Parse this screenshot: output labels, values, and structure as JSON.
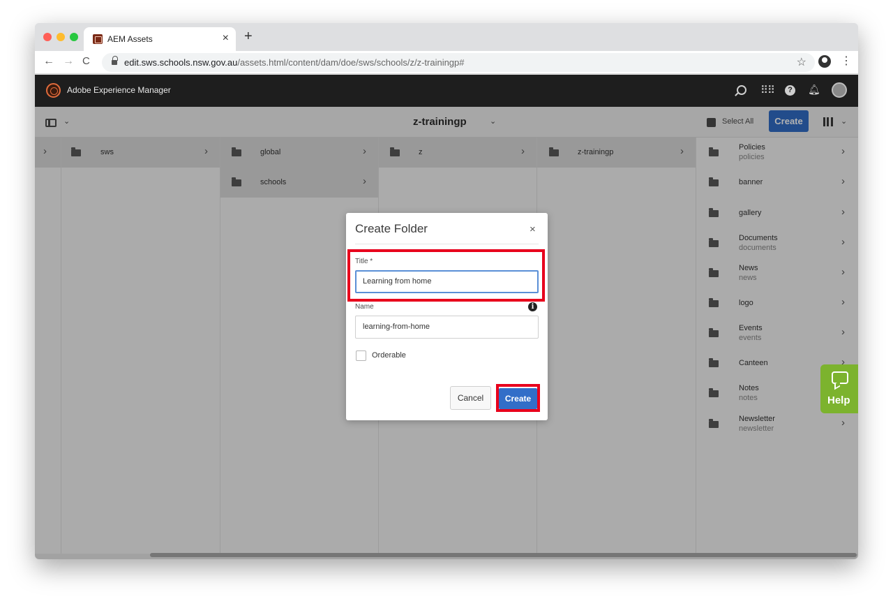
{
  "browser": {
    "tab_title": "AEM Assets",
    "tab_close": "×",
    "new_tab": "+",
    "url_host": "edit.sws.schools.nsw.gov.au",
    "url_path": "/assets.html/content/dam/doe/sws/schools/z/z-trainingp#",
    "back": "←",
    "forward": "→",
    "reload": "C",
    "star": "☆",
    "menu": "⋮"
  },
  "aem_header": {
    "title": "Adobe Experience Manager",
    "help": "?"
  },
  "actionbar": {
    "breadcrumb_title": "z-trainingp",
    "select_all": "Select All",
    "create": "Create",
    "chevron": "⌄"
  },
  "columns": {
    "col1": [
      {
        "label": "sws"
      }
    ],
    "col2": [
      {
        "label": "global"
      },
      {
        "label": "schools"
      }
    ],
    "col3": [
      {
        "label": "z"
      }
    ],
    "col4": [
      {
        "label": "z-trainingp"
      }
    ],
    "col5": [
      {
        "label": "Policies",
        "sub": "policies"
      },
      {
        "label": "banner",
        "sub": ""
      },
      {
        "label": "gallery",
        "sub": ""
      },
      {
        "label": "Documents",
        "sub": "documents"
      },
      {
        "label": "News",
        "sub": "news"
      },
      {
        "label": "logo",
        "sub": ""
      },
      {
        "label": "Events",
        "sub": "events"
      },
      {
        "label": "Canteen",
        "sub": ""
      },
      {
        "label": "Notes",
        "sub": "notes"
      },
      {
        "label": "Newsletter",
        "sub": "newsletter"
      }
    ]
  },
  "dialog": {
    "title": "Create Folder",
    "close": "×",
    "title_label": "Title *",
    "title_value": "Learning from home",
    "name_label": "Name",
    "name_value": "learning-from-home",
    "info": "i",
    "orderable_label": "Orderable",
    "orderable_checked": false,
    "cancel": "Cancel",
    "create": "Create"
  },
  "help_tab": {
    "label": "Help"
  },
  "colors": {
    "accent_blue": "#326ec8",
    "highlight_red": "#e8001c",
    "help_green": "#7cb32e"
  }
}
